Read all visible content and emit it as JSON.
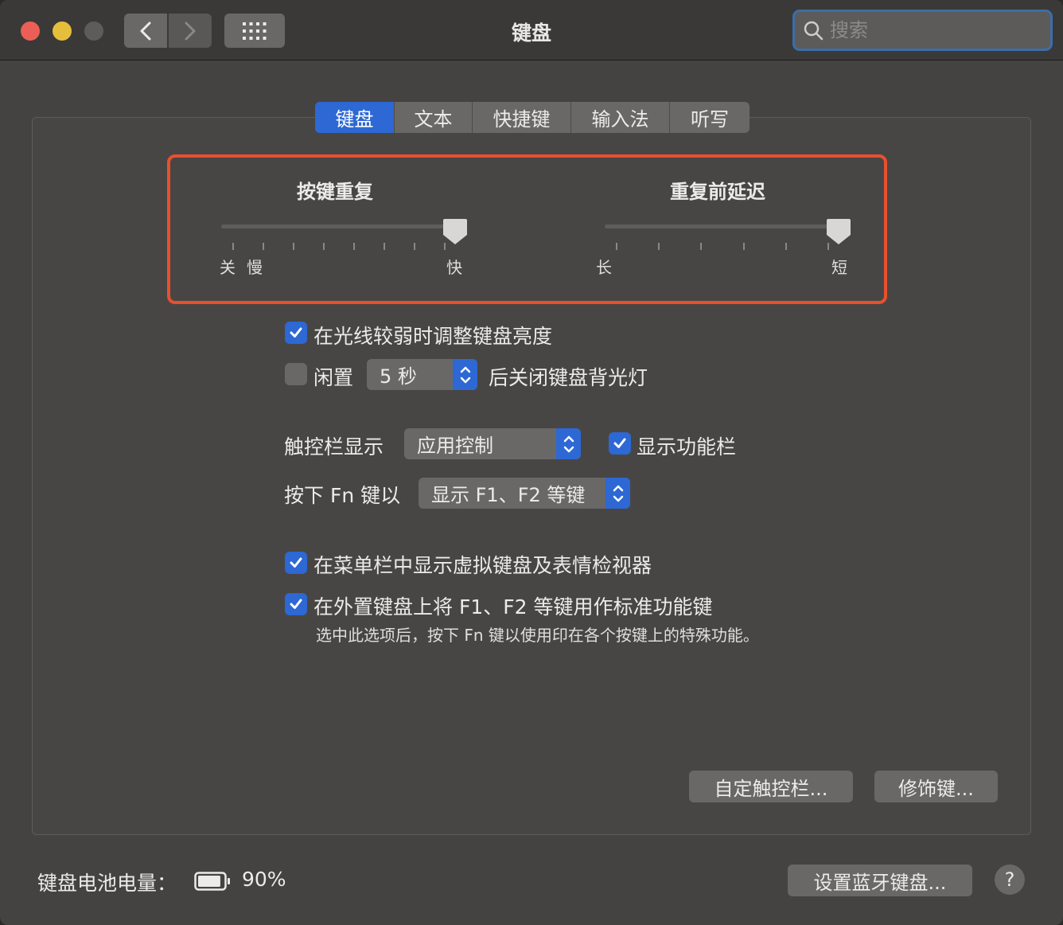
{
  "window": {
    "title": "键盘",
    "search_placeholder": "搜索"
  },
  "tabs": [
    {
      "label": "键盘",
      "active": true
    },
    {
      "label": "文本",
      "active": false
    },
    {
      "label": "快捷键",
      "active": false
    },
    {
      "label": "输入法",
      "active": false
    },
    {
      "label": "听写",
      "active": false
    }
  ],
  "key_repeat": {
    "title": "按键重复",
    "label_off": "关",
    "label_slow": "慢",
    "label_fast": "快",
    "value_fraction": 1.0
  },
  "repeat_delay": {
    "title": "重复前延迟",
    "label_long": "长",
    "label_short": "短",
    "value_fraction": 1.0
  },
  "options": {
    "adjust_brightness": {
      "label": "在光线较弱时调整键盘亮度",
      "checked": true
    },
    "backlight_idle": {
      "prefix": "闲置",
      "value": "5 秒",
      "suffix": "后关闭键盘背光灯",
      "checked": false
    },
    "touchbar_label": "触控栏显示",
    "touchbar_value": "应用控制",
    "show_function_bar": {
      "label": "显示功能栏",
      "checked": true
    },
    "fn_label": "按下 Fn 键以",
    "fn_value": "显示 F1、F2 等键",
    "show_viewer": {
      "label": "在菜单栏中显示虚拟键盘及表情检视器",
      "checked": true
    },
    "standard_fn_keys": {
      "label": "在外置键盘上将 F1、F2 等键用作标准功能键",
      "checked": true
    },
    "standard_fn_desc": "选中此选项后，按下 Fn 键以使用印在各个按键上的特殊功能。"
  },
  "buttons": {
    "customize_touchbar": "自定触控栏...",
    "modifier_keys": "修饰键...",
    "bluetooth_keyboard": "设置蓝牙键盘...",
    "help": "?"
  },
  "battery": {
    "label": "键盘电池电量：",
    "value": "90%",
    "level_fraction": 0.9
  },
  "colors": {
    "accent": "#2d68d4",
    "highlight": "#e8502e",
    "window_bg": "#454341"
  }
}
